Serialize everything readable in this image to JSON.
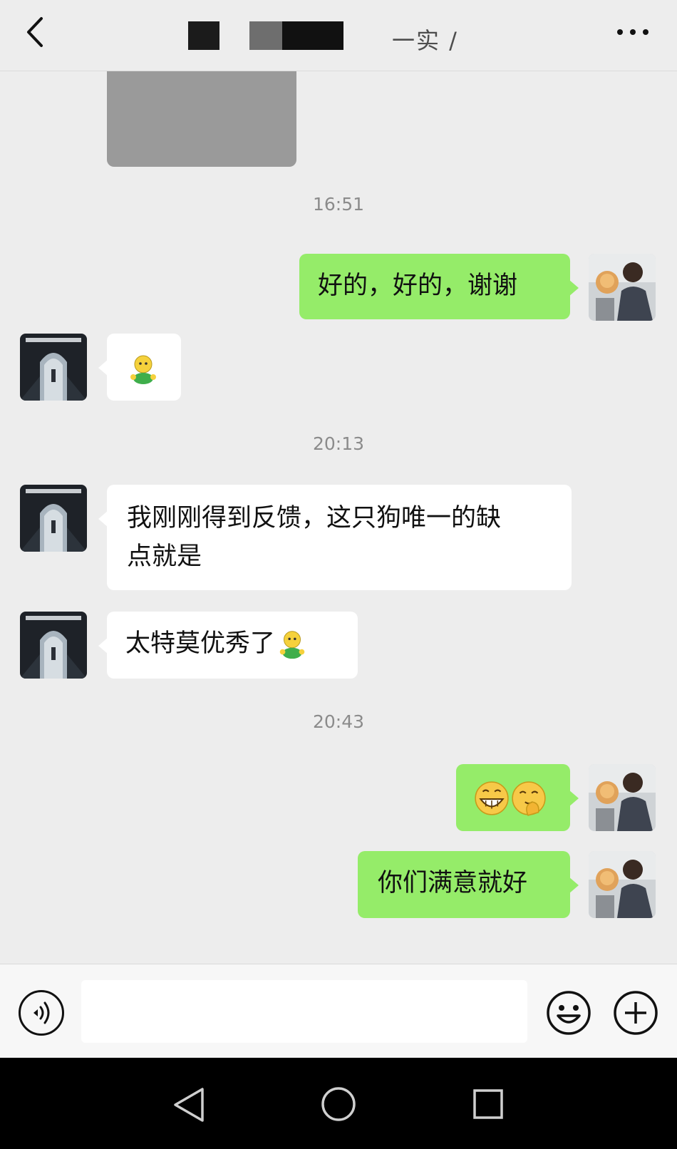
{
  "header": {
    "title_fragment": "一实 /",
    "back_icon": "chevron-left-icon",
    "more_icon": "more-dots-icon"
  },
  "messages": [
    {
      "kind": "time",
      "text": "16:51"
    },
    {
      "kind": "me",
      "text": "好的，好的，谢谢"
    },
    {
      "kind": "them",
      "emoji": "tutu-emoji"
    },
    {
      "kind": "time",
      "text": "20:13"
    },
    {
      "kind": "them",
      "text": "我刚刚得到反馈，这只狗唯一的缺点就是"
    },
    {
      "kind": "them",
      "text": "太特莫优秀了",
      "emoji": "tutu-emoji"
    },
    {
      "kind": "time",
      "text": "20:43"
    },
    {
      "kind": "me",
      "emoji": [
        "grin-emoji",
        "snicker-emoji"
      ]
    },
    {
      "kind": "me",
      "text": "你们满意就好"
    }
  ],
  "times": {
    "t1": "16:51",
    "t2": "20:13",
    "t3": "20:43"
  },
  "bubbles": {
    "me1": "好的，好的，谢谢",
    "them2": "我刚刚得到反馈，这只狗唯一的缺",
    "them2b": "点就是",
    "them3": "太特莫优秀了",
    "me3": "你们满意就好"
  },
  "input": {
    "placeholder": "",
    "voice_icon": "voice-icon",
    "emoji_icon": "emoji-icon",
    "plus_icon": "plus-icon"
  },
  "navbar": {
    "back_icon": "nav-back-icon",
    "home_icon": "nav-home-icon",
    "recent_icon": "nav-recent-icon"
  },
  "colors": {
    "background": "#ededed",
    "my_bubble": "#95ec69",
    "their_bubble": "#ffffff",
    "timestamp": "#8b8b8b"
  }
}
